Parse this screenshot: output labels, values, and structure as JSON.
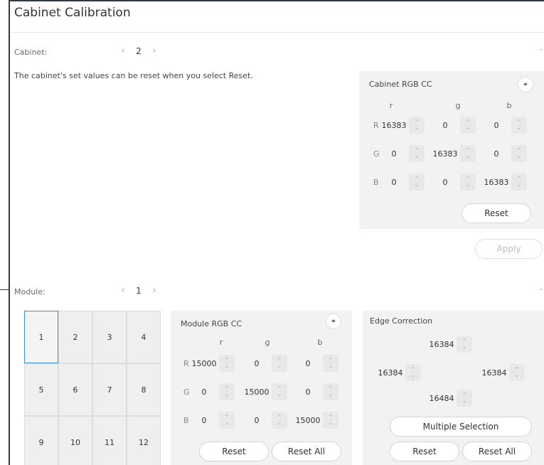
{
  "title": "Cabinet Calibration",
  "cabinet": {
    "label": "Cabinet:",
    "value": "2",
    "hint": "The cabinet's set values can be reset when you select Reset.",
    "rgb_cc": {
      "title": "Cabinet RGB CC",
      "cols": [
        "r",
        "g",
        "b"
      ],
      "rows": [
        {
          "label": "R",
          "values": [
            "16383",
            "0",
            "0"
          ]
        },
        {
          "label": "G",
          "values": [
            "0",
            "16383",
            "0"
          ]
        },
        {
          "label": "B",
          "values": [
            "0",
            "0",
            "16383"
          ]
        }
      ],
      "reset_label": "Reset"
    },
    "apply_label": "Apply"
  },
  "module": {
    "label": "Module:",
    "value": "1",
    "cells": [
      "1",
      "2",
      "3",
      "4",
      "5",
      "6",
      "7",
      "8",
      "9",
      "10",
      "11",
      "12"
    ],
    "selected_cell": "1",
    "rgb_cc": {
      "title": "Module RGB CC",
      "cols": [
        "r",
        "g",
        "b"
      ],
      "rows": [
        {
          "label": "R",
          "values": [
            "15000",
            "0",
            "0"
          ]
        },
        {
          "label": "G",
          "values": [
            "0",
            "15000",
            "0"
          ]
        },
        {
          "label": "B",
          "values": [
            "0",
            "0",
            "15000"
          ]
        }
      ],
      "reset_label": "Reset",
      "reset_all_label": "Reset All"
    },
    "edge": {
      "title": "Edge Correction",
      "top": "16384",
      "left": "16384",
      "right": "16384",
      "bottom": "16484",
      "multiple_label": "Multiple Selection",
      "reset_label": "Reset",
      "reset_all_label": "Reset All"
    }
  },
  "icons": {
    "left_arrow": "chevron-left-icon",
    "right_arrow": "chevron-right-icon",
    "link": "link-icon",
    "stepper": "spin-stepper-icon"
  }
}
